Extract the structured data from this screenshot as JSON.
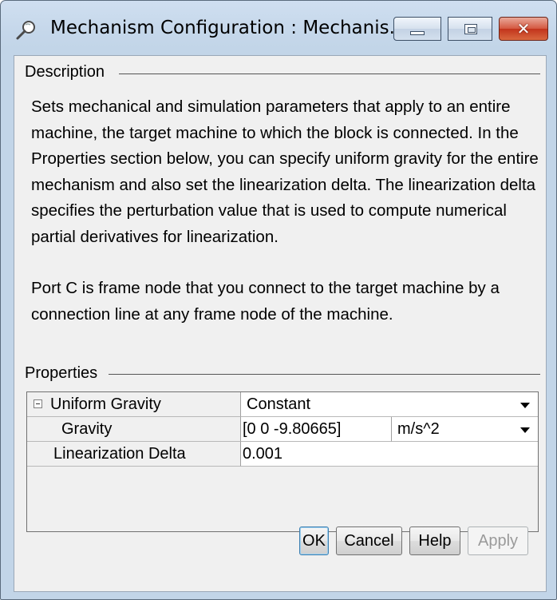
{
  "window": {
    "title": "Mechanism Configuration : Mechanis...",
    "controls": {
      "minimize": "minimize",
      "maximize": "maximize",
      "close": "✕"
    }
  },
  "description": {
    "group_label": "Description",
    "paragraph1": "Sets mechanical and simulation parameters that apply to an entire machine, the target machine to which the block is connected. In the Properties section below, you can specify uniform gravity for the entire mechanism and also set the linearization delta. The linearization delta specifies the perturbation value that is used to compute numerical partial derivatives for linearization.",
    "paragraph2": "Port C is frame node that you connect to the target machine by a connection line at any frame node of the machine."
  },
  "properties": {
    "group_label": "Properties",
    "rows": [
      {
        "name": "Uniform Gravity",
        "value": "Constant"
      },
      {
        "name": "Gravity",
        "value": "[0 0 -9.80665]",
        "unit": "m/s^2"
      },
      {
        "name": "Linearization Delta",
        "value": "0.001"
      }
    ]
  },
  "buttons": {
    "ok": "OK",
    "cancel": "Cancel",
    "help": "Help",
    "apply": "Apply"
  },
  "colors": {
    "title_bar": "#c5d7ea",
    "client_bg": "#f0f0f0",
    "close_button": "#c2331c",
    "disabled_text": "#9a9a9a"
  },
  "icons": [
    "magnifier-icon",
    "minimize-icon",
    "maximize-icon",
    "close-icon",
    "collapse-icon",
    "dropdown-arrow-icon"
  ]
}
